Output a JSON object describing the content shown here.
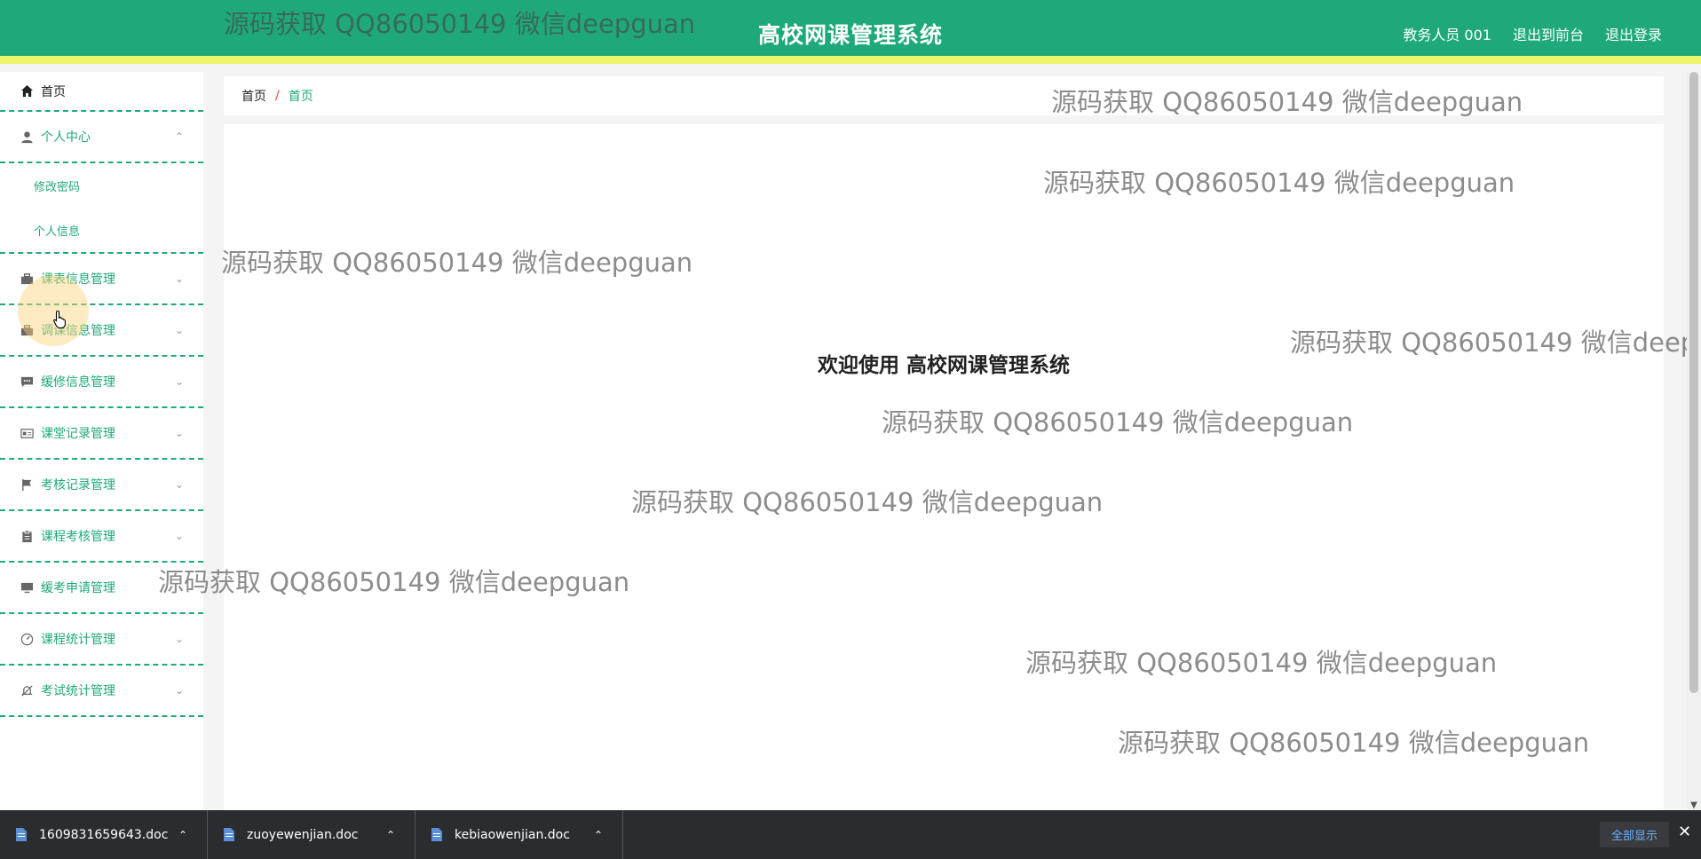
{
  "header": {
    "title": "高校网课管理系统",
    "user": "教务人员 001",
    "back_frontend": "退出到前台",
    "logout": "退出登录"
  },
  "sidebar": {
    "home": "首页",
    "personal_center": {
      "label": "个人中心",
      "children": [
        "修改密码",
        "个人信息"
      ]
    },
    "items": [
      {
        "label": "课表信息管理",
        "icon": "briefcase-icon"
      },
      {
        "label": "调课信息管理",
        "icon": "suitcase-icon"
      },
      {
        "label": "缓修信息管理",
        "icon": "chat-icon"
      },
      {
        "label": "课堂记录管理",
        "icon": "id-card-icon"
      },
      {
        "label": "考核记录管理",
        "icon": "flag-icon"
      },
      {
        "label": "课程考核管理",
        "icon": "clipboard-icon"
      },
      {
        "label": "缓考申请管理",
        "icon": "monitor-icon"
      },
      {
        "label": "课程统计管理",
        "icon": "gauge-icon"
      },
      {
        "label": "考试统计管理",
        "icon": "bell-off-icon"
      }
    ]
  },
  "breadcrumb": {
    "home": "首页",
    "separator": "/",
    "current": "首页"
  },
  "main": {
    "welcome": "欢迎使用 高校网课管理系统"
  },
  "watermark": "源码获取 QQ86050149 微信deepguan",
  "downloads": {
    "items": [
      "1609831659643.doc",
      "zuoyewenjian.doc",
      "kebiaowenjian.doc"
    ],
    "show_all": "全部显示"
  },
  "colors": {
    "header": "#1fa97a",
    "accent_strip": "#eef56c",
    "menu_text": "#1fa97a",
    "download_bar": "#2b2c2f"
  }
}
